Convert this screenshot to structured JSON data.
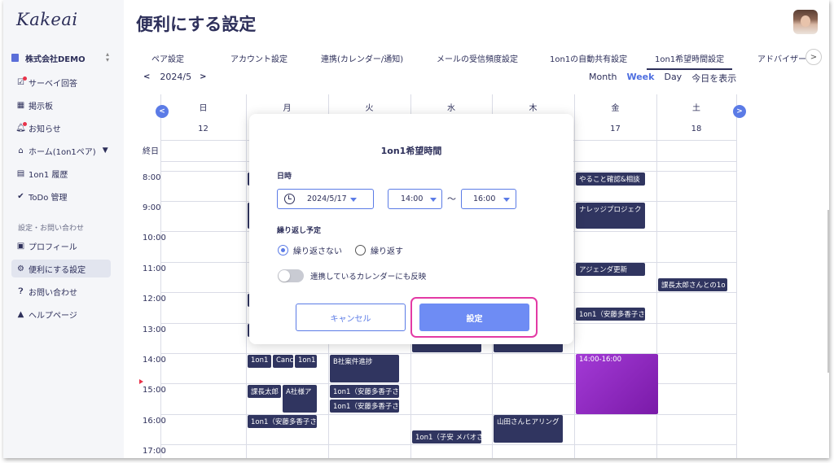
{
  "app": {
    "logo": "Kakeai",
    "company": "株式会社DEMO"
  },
  "sidebar": {
    "items": [
      {
        "label": "サーベイ回答",
        "icon": "survey-icon",
        "badge": true
      },
      {
        "label": "掲示板",
        "icon": "board-icon",
        "badge": false
      },
      {
        "label": "お知らせ",
        "icon": "bell-icon",
        "badge": true
      },
      {
        "label": "ホーム(1on1ペア)",
        "icon": "home-icon",
        "badge": false
      },
      {
        "label": "1on1 履歴",
        "icon": "history-icon",
        "badge": false
      },
      {
        "label": "ToDo 管理",
        "icon": "check-icon",
        "badge": false
      }
    ],
    "section": "設定・お問い合わせ",
    "settings": [
      {
        "label": "プロフィール",
        "icon": "briefcase-icon"
      },
      {
        "label": "便利にする設定",
        "icon": "gear-icon"
      },
      {
        "label": "お問い合わせ",
        "icon": "question-icon"
      },
      {
        "label": "ヘルプページ",
        "icon": "graduation-cap-icon"
      }
    ]
  },
  "header": {
    "title": "便利にする設定"
  },
  "tabs": [
    "ペア設定",
    "アカウント設定",
    "連携(カレンダー/通知)",
    "メールの受信頻度設定",
    "1on1の自動共有設定",
    "1on1希望時間設定",
    "アドバイザー"
  ],
  "calendar": {
    "month": "2024/5",
    "views": {
      "month": "Month",
      "week": "Week",
      "day": "Day",
      "today": "今日を表示"
    },
    "days": [
      {
        "name": "日",
        "date": "12"
      },
      {
        "name": "月",
        "date": ""
      },
      {
        "name": "火",
        "date": ""
      },
      {
        "name": "水",
        "date": ""
      },
      {
        "name": "木",
        "date": ""
      },
      {
        "name": "金",
        "date": "17"
      },
      {
        "name": "土",
        "date": "18"
      }
    ],
    "allday": "終日",
    "times": [
      "8:00",
      "9:00",
      "10:00",
      "11:00",
      "12:00",
      "13:00",
      "14:00",
      "15:00",
      "16:00",
      "17:00"
    ],
    "events": {
      "fri_a": "やること確認&相談",
      "fri_b": "ナレッジプロジェク",
      "fri_c": "アジェンダ更新",
      "fri_d": "1on1（安藤多香子さ",
      "fri_sel": "14:00-16:00",
      "sat_a": "課長太郎さんとの1o",
      "mon_a": "1on1",
      "mon_b": "Canc",
      "mon_c": "1on1",
      "mon_d": "課長太郎",
      "mon_e": "A社様ア",
      "mon_f": "1on1（安藤多香子さ",
      "tue_a": "B社案件進捗",
      "tue_b": "1on1（安藤多香子さ",
      "tue_c": "1on1（安藤多香子さ",
      "wed_a": "1on1（子安 メバオさ",
      "thu_a": "山田さんヒアリング"
    }
  },
  "modal": {
    "title": "1on1希望時間",
    "date_label": "日時",
    "date_value": "2024/5/17",
    "start_time": "14:00",
    "end_time": "16:00",
    "tilde": "〜",
    "repeat_label": "繰り返し予定",
    "repeat_none": "繰り返さない",
    "repeat_yes": "繰り返す",
    "sync_label": "連携しているカレンダーにも反映",
    "cancel": "キャンセル",
    "submit": "設定"
  },
  "colors": {
    "accent": "#5b7be6",
    "event": "#303560",
    "highlight": "#e33aa5",
    "selection": "#a33ad6"
  }
}
